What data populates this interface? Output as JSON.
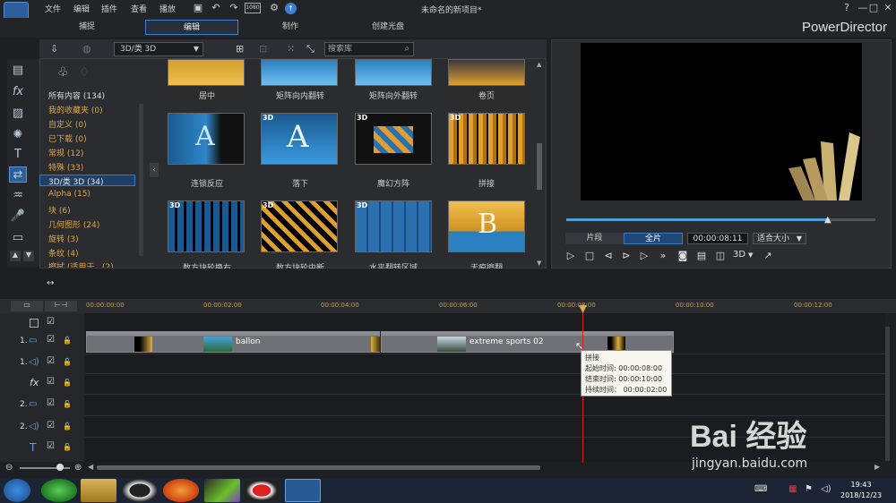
{
  "menu": [
    "文件",
    "编辑",
    "插件",
    "查看",
    "播放"
  ],
  "zoom_label": "1080",
  "window": {
    "title": "未命名的新项目*",
    "help": "?",
    "minimize": "—",
    "maximize": "□",
    "close": "✕"
  },
  "modes": [
    "捕捉",
    "编辑",
    "制作",
    "创建光盘"
  ],
  "brand": "PowerDirector",
  "library": {
    "dropdown": "3D/类 3D",
    "search_placeholder": "搜索库",
    "categories": [
      "所有内容 (134)",
      "我的收藏夹 (0)",
      "自定义 (0)",
      "已下载 (0)",
      "常规 (12)",
      "特殊 (33)",
      "3D/类 3D (34)",
      "Alpha (15)",
      "块 (6)",
      "几何图形 (24)",
      "旋转 (3)",
      "条纹 (4)",
      "擦拭 (适用于...(2)"
    ],
    "top_row_labels": [
      "居中",
      "矩阵向内翻转",
      "矩阵向外翻转",
      "卷页"
    ],
    "row2": [
      {
        "label": "连锁反应",
        "badge": ""
      },
      {
        "label": "落下",
        "badge": "3D"
      },
      {
        "label": "魔幻方阵",
        "badge": "3D"
      },
      {
        "label": "拼接",
        "badge": "3D"
      }
    ],
    "row3": [
      {
        "label": "数方块轮换右",
        "badge": "3D"
      },
      {
        "label": "数方块轮中断",
        "badge": "3D"
      },
      {
        "label": "水平翻转区域",
        "badge": "3D"
      },
      {
        "label": "无痕擦翻",
        "badge": ""
      }
    ]
  },
  "preview": {
    "tab_clip": "片段",
    "tab_movie": "全片",
    "timecode": "00:00:08:11",
    "fit": "适合大小",
    "mode3d": "3D",
    "slider_fraction": 0.85
  },
  "timeline": {
    "ticks": [
      "00:00:00:00",
      "00:00:02:00",
      "00:00:04:00",
      "00:00:06:00",
      "00:00:08:00",
      "00:00:10:00",
      "00:00:12:00"
    ],
    "tracks": [
      {
        "num": "1.",
        "type": "video"
      },
      {
        "num": "1.",
        "type": "audio"
      },
      {
        "num": "",
        "type": "fx"
      },
      {
        "num": "2.",
        "type": "video"
      },
      {
        "num": "2.",
        "type": "audio"
      },
      {
        "num": "",
        "type": "title"
      }
    ],
    "clips": [
      "ballon",
      "extreme sports 02"
    ],
    "tooltip": {
      "title": "拼接",
      "start": "起始时间: 00:00:08:00",
      "end": "结束时间: 00:00:10:00",
      "duration": "持续时间： 00:00:02:00"
    }
  },
  "taskbar": {
    "time": "19:43",
    "date": "2018/12/23"
  },
  "watermark": {
    "text": "Bai 经验",
    "url": "jingyan.baidu.com"
  }
}
